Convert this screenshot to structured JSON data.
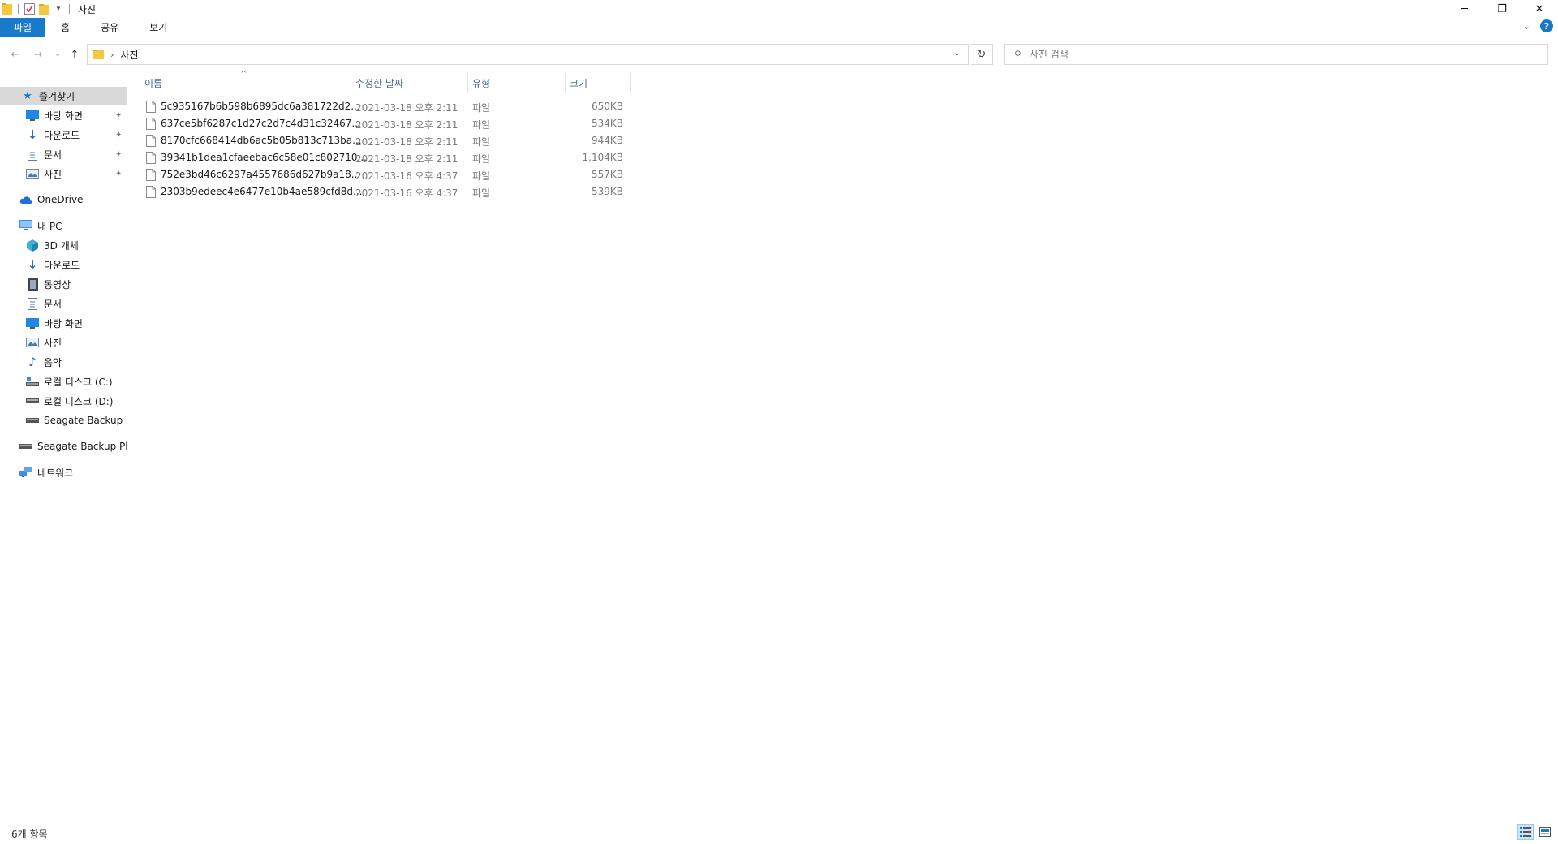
{
  "window": {
    "title": "사진",
    "minimize": "─",
    "restore": "❐",
    "close": "✕"
  },
  "ribbon": {
    "tabs": [
      {
        "label": "파일"
      },
      {
        "label": "홈"
      },
      {
        "label": "공유"
      },
      {
        "label": "보기"
      }
    ],
    "expand_icon": "⌄",
    "help_label": "?"
  },
  "nav": {
    "back": "←",
    "forward": "→",
    "recent": "⌄",
    "up": "↑",
    "breadcrumb_sep": "›",
    "breadcrumb": "사진",
    "address_dropdown": "⌄",
    "refresh": "↻",
    "search_icon": "⚲",
    "search_placeholder": "사진 검색"
  },
  "sidebar": {
    "quick_access": "즐겨찾기",
    "quick_items": [
      {
        "label": "바탕 화면",
        "icon": "desktop-icon"
      },
      {
        "label": "다운로드",
        "icon": "download-icon"
      },
      {
        "label": "문서",
        "icon": "document-icon"
      },
      {
        "label": "사진",
        "icon": "pictures-icon"
      }
    ],
    "pin_glyph": "📌",
    "onedrive": "OneDrive",
    "this_pc": "내 PC",
    "pc_items": [
      {
        "label": "3D 개체",
        "icon": "3d-objects-icon"
      },
      {
        "label": "다운로드",
        "icon": "download-icon"
      },
      {
        "label": "동영상",
        "icon": "video-icon"
      },
      {
        "label": "문서",
        "icon": "document-icon"
      },
      {
        "label": "바탕 화면",
        "icon": "desktop-icon"
      },
      {
        "label": "사진",
        "icon": "pictures-icon"
      },
      {
        "label": "음악",
        "icon": "music-icon"
      },
      {
        "label": "로컬 디스크 (C:)",
        "icon": "system-drive-icon"
      },
      {
        "label": "로컬 디스크 (D:)",
        "icon": "drive-icon"
      },
      {
        "label": "Seagate Backup Plu",
        "icon": "drive-icon"
      }
    ],
    "external_drive": "Seagate Backup Plus",
    "network": "네트워크"
  },
  "columns": {
    "name": "이름",
    "date": "수정한 날짜",
    "type": "유형",
    "size": "크기",
    "sort_indicator": "^"
  },
  "files": [
    {
      "name": "5c935167b6b598b6895dc6a381722d2...",
      "date": "2021-03-18 오후 2:11",
      "type": "파일",
      "size": "650KB"
    },
    {
      "name": "637ce5bf6287c1d27c2d7c4d31c32467...",
      "date": "2021-03-18 오후 2:11",
      "type": "파일",
      "size": "534KB"
    },
    {
      "name": "8170cfc668414db6ac5b05b813c713ba...",
      "date": "2021-03-18 오후 2:11",
      "type": "파일",
      "size": "944KB"
    },
    {
      "name": "39341b1dea1cfaeebac6c58e01c802710...",
      "date": "2021-03-18 오후 2:11",
      "type": "파일",
      "size": "1,104KB"
    },
    {
      "name": "752e3bd46c6297a4557686d627b9a18...",
      "date": "2021-03-16 오후 4:37",
      "type": "파일",
      "size": "557KB"
    },
    {
      "name": "2303b9edeec4e6477e10b4ae589cfd8d...",
      "date": "2021-03-16 오후 4:37",
      "type": "파일",
      "size": "539KB"
    }
  ],
  "status": {
    "item_count": "6개 항목"
  },
  "colors": {
    "accent": "#1979ca",
    "selected_nav": "#d9d9d9",
    "header_text": "#4a6c8c",
    "folder_yellow": "#f5c842"
  }
}
